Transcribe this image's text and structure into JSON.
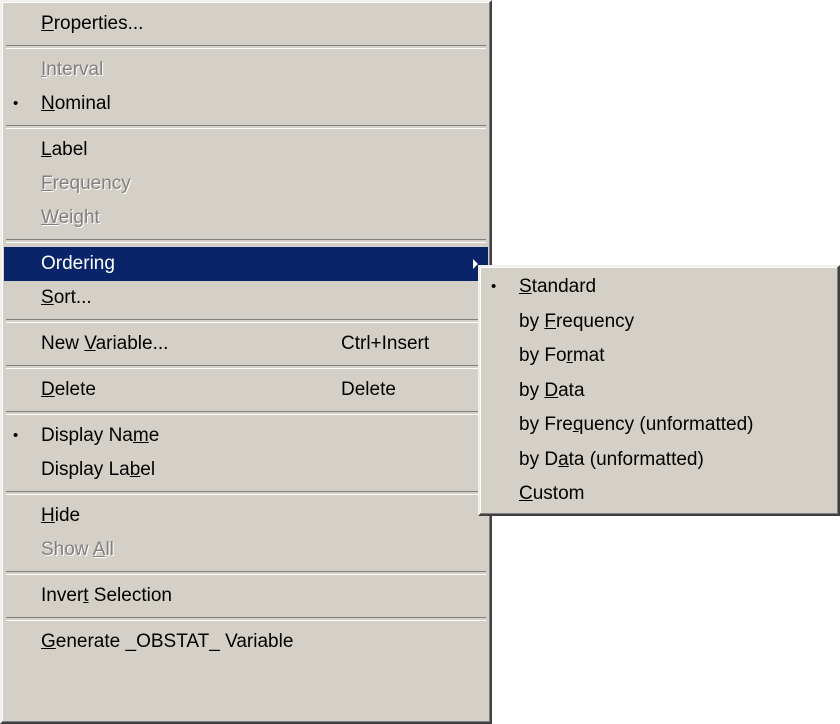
{
  "main_menu": {
    "items": [
      {
        "label_parts": [
          "",
          "P",
          "roperties..."
        ]
      },
      {
        "label_parts": [
          "",
          "I",
          "nterval"
        ]
      },
      {
        "label_parts": [
          "",
          "N",
          "ominal"
        ],
        "bullet": "•"
      },
      {
        "label_parts": [
          "",
          "L",
          "abel"
        ]
      },
      {
        "label_parts": [
          "",
          "F",
          "requency"
        ]
      },
      {
        "label_parts": [
          "",
          "W",
          "eight"
        ]
      },
      {
        "label": "Ordering"
      },
      {
        "label_parts": [
          "",
          "S",
          "ort..."
        ]
      },
      {
        "label_parts": [
          "New ",
          "V",
          "ariable..."
        ],
        "shortcut": "Ctrl+Insert"
      },
      {
        "label_parts": [
          "",
          "D",
          "elete"
        ],
        "shortcut": "Delete"
      },
      {
        "label_parts": [
          "Display Na",
          "m",
          "e"
        ],
        "bullet": "•"
      },
      {
        "label_parts": [
          "Display La",
          "b",
          "el"
        ]
      },
      {
        "label_parts": [
          "",
          "H",
          "ide"
        ]
      },
      {
        "label_parts": [
          "Show ",
          "A",
          "ll"
        ]
      },
      {
        "label_parts": [
          "Inver",
          "t",
          " Selection"
        ]
      },
      {
        "label_parts": [
          "",
          "G",
          "enerate _OBSTAT_ Variable"
        ]
      }
    ]
  },
  "sub_menu": {
    "items": [
      {
        "label_parts": [
          "",
          "S",
          "tandard"
        ],
        "bullet": "•"
      },
      {
        "label_parts": [
          "by ",
          "F",
          "requency"
        ]
      },
      {
        "label_parts": [
          "by Fo",
          "r",
          "mat"
        ]
      },
      {
        "label_parts": [
          "by ",
          "D",
          "ata"
        ]
      },
      {
        "label_parts": [
          "by Fre",
          "q",
          "uency (unformatted)"
        ]
      },
      {
        "label_parts": [
          "by D",
          "a",
          "ta (unformatted)"
        ]
      },
      {
        "label_parts": [
          "",
          "C",
          "ustom"
        ]
      }
    ]
  }
}
